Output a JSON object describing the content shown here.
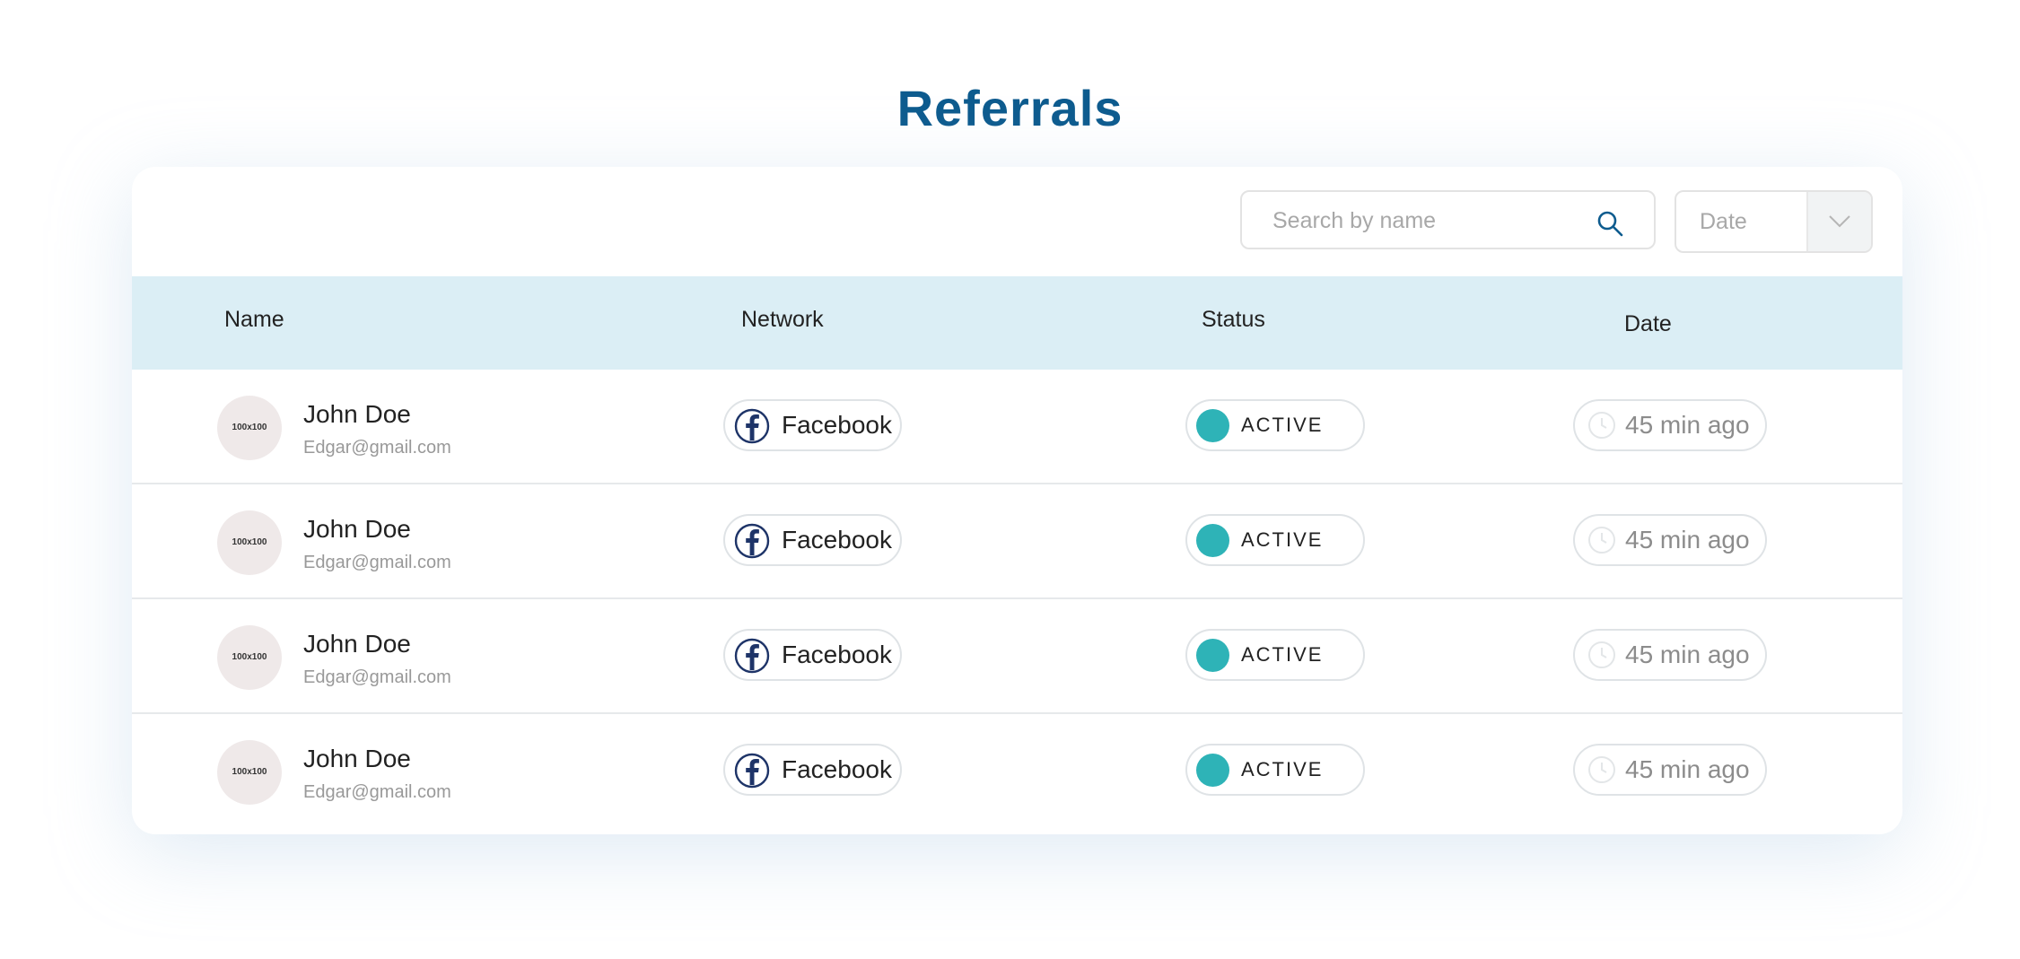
{
  "title": "Referrals",
  "colors": {
    "title": "#0d5b8e",
    "header_bg": "#dbeef5",
    "status_active": "#2eb3b7",
    "facebook": "#1e3468"
  },
  "search": {
    "placeholder": "Search by name",
    "icon": "search-icon"
  },
  "date_filter": {
    "value": "Date",
    "icon": "chevron-down-icon"
  },
  "columns": [
    "Name",
    "Network",
    "Status",
    "Date"
  ],
  "rows": [
    {
      "avatar": "100x100",
      "name": "John Doe",
      "email": "Edgar@gmail.com",
      "network": "Facebook",
      "network_icon": "facebook-icon",
      "status": "ACTIVE",
      "time": "45 min ago",
      "time_icon": "clock-icon"
    },
    {
      "avatar": "100x100",
      "name": "John Doe",
      "email": "Edgar@gmail.com",
      "network": "Facebook",
      "network_icon": "facebook-icon",
      "status": "ACTIVE",
      "time": "45 min ago",
      "time_icon": "clock-icon"
    },
    {
      "avatar": "100x100",
      "name": "John Doe",
      "email": "Edgar@gmail.com",
      "network": "Facebook",
      "network_icon": "facebook-icon",
      "status": "ACTIVE",
      "time": "45 min ago",
      "time_icon": "clock-icon"
    },
    {
      "avatar": "100x100",
      "name": "John Doe",
      "email": "Edgar@gmail.com",
      "network": "Facebook",
      "network_icon": "facebook-icon",
      "status": "ACTIVE",
      "time": "45 min ago",
      "time_icon": "clock-icon"
    }
  ]
}
